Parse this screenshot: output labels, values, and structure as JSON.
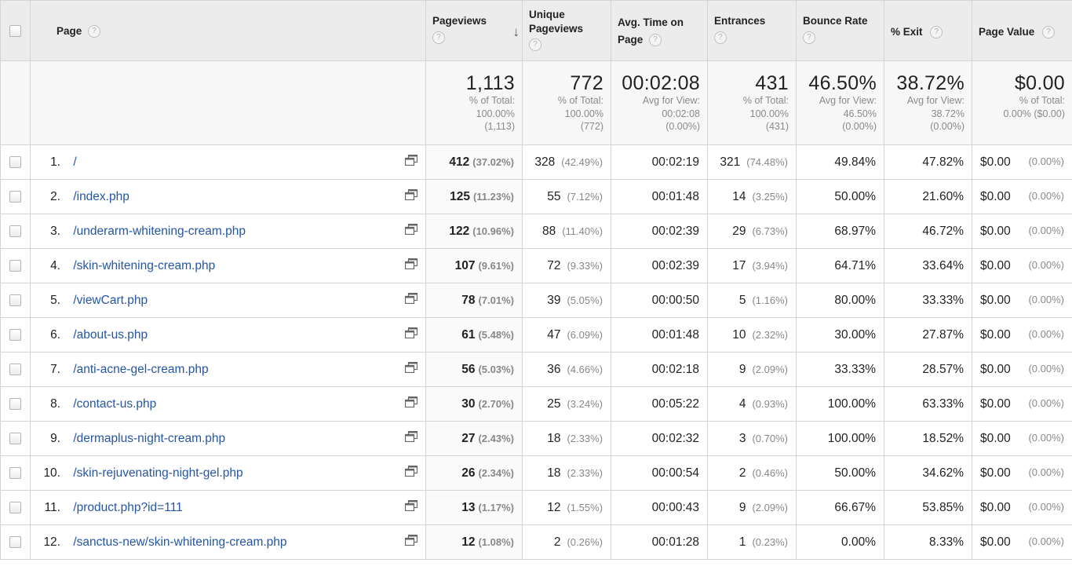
{
  "headers": {
    "page": "Page",
    "pageviews": "Pageviews",
    "unique_line1": "Unique",
    "unique_line2": "Pageviews",
    "avg_time_line1": "Avg. Time on",
    "avg_time_line2": "Page",
    "entrances": "Entrances",
    "bounce_rate": "Bounce Rate",
    "exit": "% Exit",
    "page_value": "Page Value",
    "help_glyph": "?",
    "sort_glyph": "↓"
  },
  "totals": {
    "pageviews": {
      "value": "1,113",
      "l1": "% of Total:",
      "l2": "100.00%",
      "l3": "(1,113)"
    },
    "unique": {
      "value": "772",
      "l1": "% of Total:",
      "l2": "100.00%",
      "l3": "(772)"
    },
    "avg_time": {
      "value": "00:02:08",
      "l1": "Avg for View:",
      "l2": "00:02:08",
      "l3": "(0.00%)"
    },
    "entrances": {
      "value": "431",
      "l1": "% of Total:",
      "l2": "100.00%",
      "l3": "(431)"
    },
    "bounce_rate": {
      "value": "46.50%",
      "l1": "Avg for View:",
      "l2": "46.50%",
      "l3": "(0.00%)"
    },
    "exit": {
      "value": "38.72%",
      "l1": "Avg for View:",
      "l2": "38.72%",
      "l3": "(0.00%)"
    },
    "page_value": {
      "value": "$0.00",
      "l1": "% of Total:",
      "l2": "0.00% ($0.00)"
    }
  },
  "rows": [
    {
      "index": "1.",
      "page": "/",
      "pageviews": "412",
      "pageviews_pct": "(37.02%)",
      "unique": "328",
      "unique_pct": "(42.49%)",
      "avg_time": "00:02:19",
      "entrances": "321",
      "entrances_pct": "(74.48%)",
      "bounce": "49.84%",
      "exit": "47.82%",
      "value": "$0.00",
      "value_pct": "(0.00%)"
    },
    {
      "index": "2.",
      "page": "/index.php",
      "pageviews": "125",
      "pageviews_pct": "(11.23%)",
      "unique": "55",
      "unique_pct": "(7.12%)",
      "avg_time": "00:01:48",
      "entrances": "14",
      "entrances_pct": "(3.25%)",
      "bounce": "50.00%",
      "exit": "21.60%",
      "value": "$0.00",
      "value_pct": "(0.00%)"
    },
    {
      "index": "3.",
      "page": "/underarm-whitening-cream.php",
      "pageviews": "122",
      "pageviews_pct": "(10.96%)",
      "unique": "88",
      "unique_pct": "(11.40%)",
      "avg_time": "00:02:39",
      "entrances": "29",
      "entrances_pct": "(6.73%)",
      "bounce": "68.97%",
      "exit": "46.72%",
      "value": "$0.00",
      "value_pct": "(0.00%)"
    },
    {
      "index": "4.",
      "page": "/skin-whitening-cream.php",
      "pageviews": "107",
      "pageviews_pct": "(9.61%)",
      "unique": "72",
      "unique_pct": "(9.33%)",
      "avg_time": "00:02:39",
      "entrances": "17",
      "entrances_pct": "(3.94%)",
      "bounce": "64.71%",
      "exit": "33.64%",
      "value": "$0.00",
      "value_pct": "(0.00%)"
    },
    {
      "index": "5.",
      "page": "/viewCart.php",
      "pageviews": "78",
      "pageviews_pct": "(7.01%)",
      "unique": "39",
      "unique_pct": "(5.05%)",
      "avg_time": "00:00:50",
      "entrances": "5",
      "entrances_pct": "(1.16%)",
      "bounce": "80.00%",
      "exit": "33.33%",
      "value": "$0.00",
      "value_pct": "(0.00%)"
    },
    {
      "index": "6.",
      "page": "/about-us.php",
      "pageviews": "61",
      "pageviews_pct": "(5.48%)",
      "unique": "47",
      "unique_pct": "(6.09%)",
      "avg_time": "00:01:48",
      "entrances": "10",
      "entrances_pct": "(2.32%)",
      "bounce": "30.00%",
      "exit": "27.87%",
      "value": "$0.00",
      "value_pct": "(0.00%)"
    },
    {
      "index": "7.",
      "page": "/anti-acne-gel-cream.php",
      "pageviews": "56",
      "pageviews_pct": "(5.03%)",
      "unique": "36",
      "unique_pct": "(4.66%)",
      "avg_time": "00:02:18",
      "entrances": "9",
      "entrances_pct": "(2.09%)",
      "bounce": "33.33%",
      "exit": "28.57%",
      "value": "$0.00",
      "value_pct": "(0.00%)"
    },
    {
      "index": "8.",
      "page": "/contact-us.php",
      "pageviews": "30",
      "pageviews_pct": "(2.70%)",
      "unique": "25",
      "unique_pct": "(3.24%)",
      "avg_time": "00:05:22",
      "entrances": "4",
      "entrances_pct": "(0.93%)",
      "bounce": "100.00%",
      "exit": "63.33%",
      "value": "$0.00",
      "value_pct": "(0.00%)"
    },
    {
      "index": "9.",
      "page": "/dermaplus-night-cream.php",
      "pageviews": "27",
      "pageviews_pct": "(2.43%)",
      "unique": "18",
      "unique_pct": "(2.33%)",
      "avg_time": "00:02:32",
      "entrances": "3",
      "entrances_pct": "(0.70%)",
      "bounce": "100.00%",
      "exit": "18.52%",
      "value": "$0.00",
      "value_pct": "(0.00%)"
    },
    {
      "index": "10.",
      "page": "/skin-rejuvenating-night-gel.php",
      "pageviews": "26",
      "pageviews_pct": "(2.34%)",
      "unique": "18",
      "unique_pct": "(2.33%)",
      "avg_time": "00:00:54",
      "entrances": "2",
      "entrances_pct": "(0.46%)",
      "bounce": "50.00%",
      "exit": "34.62%",
      "value": "$0.00",
      "value_pct": "(0.00%)"
    },
    {
      "index": "11.",
      "page": "/product.php?id=111",
      "pageviews": "13",
      "pageviews_pct": "(1.17%)",
      "unique": "12",
      "unique_pct": "(1.55%)",
      "avg_time": "00:00:43",
      "entrances": "9",
      "entrances_pct": "(2.09%)",
      "bounce": "66.67%",
      "exit": "53.85%",
      "value": "$0.00",
      "value_pct": "(0.00%)"
    },
    {
      "index": "12.",
      "page": "/sanctus-new/skin-whitening-cream.php",
      "pageviews": "12",
      "pageviews_pct": "(1.08%)",
      "unique": "2",
      "unique_pct": "(0.26%)",
      "avg_time": "00:01:28",
      "entrances": "1",
      "entrances_pct": "(0.23%)",
      "bounce": "0.00%",
      "exit": "8.33%",
      "value": "$0.00",
      "value_pct": "(0.00%)"
    }
  ]
}
